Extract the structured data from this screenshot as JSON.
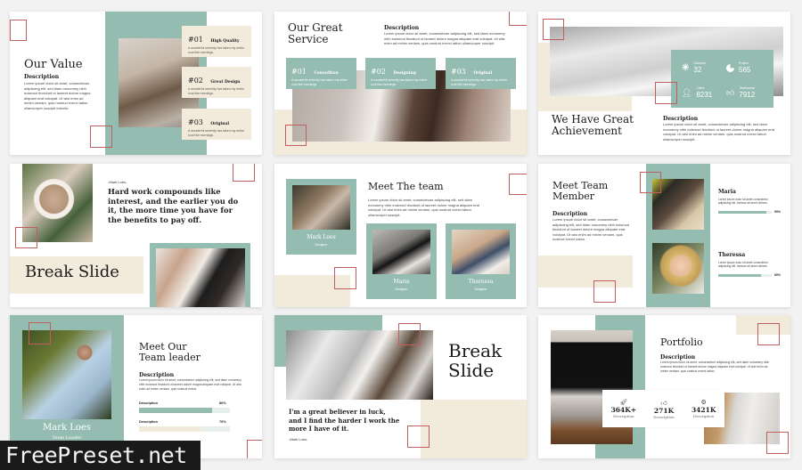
{
  "slides": {
    "our_value": {
      "title": "Our Value",
      "description_heading": "Description",
      "description_body": "Lorem ipsum dolor sit amet, consectetuer adipiscing elit, sed diam nonummy nibh euismod tincidunt ut laoreet dolore magna aliquam erat volutpat. Ut wisi enim ad minim veniam, quis nostrud exerci tation ullamcorper suscipit lobortis.",
      "items": [
        {
          "number": "#01",
          "title": "High Quality",
          "body": "A wonderful serenity has taken my entire soul like mornings."
        },
        {
          "number": "#02",
          "title": "Great Design",
          "body": "A wonderful serenity has taken my entire soul like mornings."
        },
        {
          "number": "#03",
          "title": "Original",
          "body": "A wonderful serenity has taken my entire soul like mornings."
        }
      ]
    },
    "our_service": {
      "title_line1": "Our Great",
      "title_line2": "Service",
      "description_heading": "Description",
      "description_body": "Lorem ipsum dolor sit amet, consectetuer adipiscing elit, sed diam nonummy nibh euismod tincidunt ut laoreet dolore magna aliquam erat volutpat. Ut wisi enim ad minim veniam, quis nostrud exerci tation ullamcorper suscipit.",
      "items": [
        {
          "number": "#01",
          "title": "Consultion",
          "body": "A wonderful serenity has taken my entire soul like mornings."
        },
        {
          "number": "#02",
          "title": "Designing",
          "body": "A wonderful serenity has taken my entire soul like mornings."
        },
        {
          "number": "#03",
          "title": "Original",
          "body": "A wonderful serenity has taken my entire soul like mornings."
        }
      ]
    },
    "achievement": {
      "title_line1": "We Have Great",
      "title_line2": "Achievement",
      "description_heading": "Description",
      "description_body": "Lorem ipsum dolor sit amet, consectetuer adipiscing elit, sed diam nonummy nibh euismod tincidunt ut laoreet dolore magna aliquam erat volutpat. Ut wisi enim ad minim veniam, quis nostrud exerci tation ullamcorper suscipit.",
      "stats": [
        {
          "icon": "asterisk-icon",
          "label": "Success",
          "value": "32"
        },
        {
          "icon": "pie-chart-icon",
          "label": "Project",
          "value": "565"
        },
        {
          "icon": "user-icon",
          "label": "Client",
          "value": "8231"
        },
        {
          "icon": "thumbs-up-icon",
          "label": "Testimonial",
          "value": "7912"
        }
      ]
    },
    "break1": {
      "author": "-Mark Loes-",
      "quote": "Hard work compounds like interest, and the earlier you do it, the more time you have for the benefits to pay off.",
      "title": "Break Slide"
    },
    "meet_team": {
      "title": "Meet The team",
      "body": "Lorem ipsum dolor sit amet, consectetuer adipiscing elit, sed diam nonummy nibh euismod tincidunt ut laoreet dolore magna aliquam erat volutpat. Ut wisi enim ad minim veniam, quis nostrud exerci tation ullamcorper suscipit.",
      "members": [
        {
          "name": "Mark Loes",
          "role": "Designer"
        },
        {
          "name": "Maria",
          "role": "Designer"
        },
        {
          "name": "Theressa",
          "role": "Designer"
        }
      ]
    },
    "team_member": {
      "title_line1": "Meet Team",
      "title_line2": "Member",
      "description_heading": "Description",
      "description_body": "Lorem ipsum dolor sit amet, consectetuer adipiscing elit, sed diam nonummy nibh euismod tincidunt ut laoreet dolore magna aliquam erat volutpat. Ut wisi enim ad minim veniam, quis nostrud exerci tation.",
      "members": [
        {
          "name": "Maria",
          "body": "Lorem ipsum dolor sit amet consectetur adipiscing elit. Aenean sit amet ultrices.",
          "percent_label": "90%",
          "progress": 90
        },
        {
          "name": "Theressa",
          "body": "Lorem ipsum dolor sit amet consectetur adipiscing elit. Aenean sit amet ultrices.",
          "percent_label": "80%",
          "progress": 80
        }
      ]
    },
    "team_leader": {
      "title_line1": "Meet Our",
      "title_line2": "Team leader",
      "description_heading": "Description",
      "description_body": "Lorem ipsum dolor sit amet, consectetuer adipiscing elit, sed diam nonummy nibh euismod tincidunt ut laoreet dolore magna aliquam erat volutpat. Ut wisi enim ad minim veniam, quis nostrud exerci.",
      "name": "Mark Loes",
      "role": "Team Leader",
      "bars": [
        {
          "label": "Description",
          "percent_label": "80%",
          "progress": 80,
          "color": "#94bcb1"
        },
        {
          "label": "Description",
          "percent_label": "70%",
          "progress": 70,
          "color": "#f2ebdb"
        }
      ]
    },
    "break2": {
      "title_line1": "Break",
      "title_line2": "Slide",
      "quote": "I'm a great believer in luck, and I find the harder I work the more I have of it.",
      "author": "-Mark Loes-"
    },
    "portfolio": {
      "title": "Portfolio",
      "description_heading": "Description",
      "description_body": "Lorem ipsum dolor sit amet, consectetuer adipiscing elit, sed diam nonummy nibh euismod tincidunt ut laoreet dolore magna aliquam erat volutpat. Ut wisi enim ad minim veniam, quis nostrud exerci tation.",
      "stats": [
        {
          "icon": "rocket-icon",
          "value": "364K+",
          "label": "Description"
        },
        {
          "icon": "thumbs-up-icon",
          "value": "271K",
          "label": "Description"
        },
        {
          "icon": "gear-icon",
          "value": "3421K",
          "label": "Description"
        }
      ]
    }
  },
  "watermark": "FreePreset.net",
  "colors": {
    "teal": "#94bcb1",
    "cream": "#f2ebdb",
    "accent_red": "#c0605e"
  }
}
